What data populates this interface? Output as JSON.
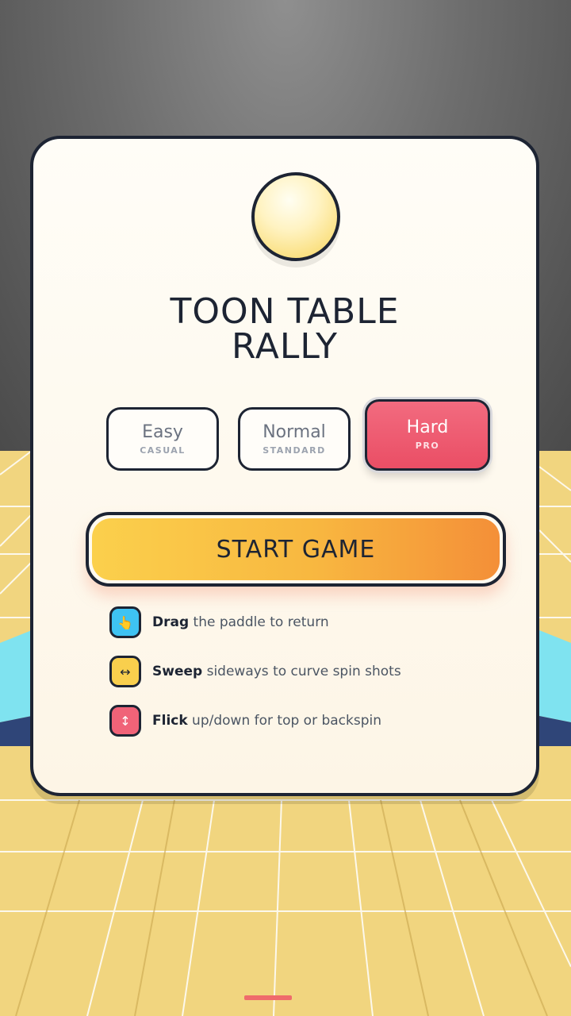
{
  "game": {
    "title_line1": "TOON TABLE",
    "title_line2": "RALLY"
  },
  "modes": [
    {
      "name": "Easy",
      "sub": "CASUAL",
      "selected": false
    },
    {
      "name": "Normal",
      "sub": "STANDARD",
      "selected": false
    },
    {
      "name": "Hard",
      "sub": "PRO",
      "selected": true
    }
  ],
  "start_button": {
    "label": "START GAME"
  },
  "tips": [
    {
      "icon": "pointing-hand-icon",
      "glyph": "👆",
      "color": "#3ec3f3",
      "verb": "Drag",
      "rest": " the paddle to return"
    },
    {
      "icon": "left-right-arrow-icon",
      "glyph": "↔",
      "color": "#f9cf4d",
      "verb": "Sweep",
      "rest": " sideways to curve spin shots"
    },
    {
      "icon": "up-down-arrow-icon",
      "glyph": "↕",
      "color": "#f06378",
      "verb": "Flick",
      "rest": " up/down for top or backspin"
    }
  ],
  "colors": {
    "accent_hard": "#ea4e65",
    "start_gradient_start": "#fbd04c",
    "start_gradient_end": "#f48f38",
    "outline": "#1d2433",
    "floor": "#f1d57f"
  }
}
